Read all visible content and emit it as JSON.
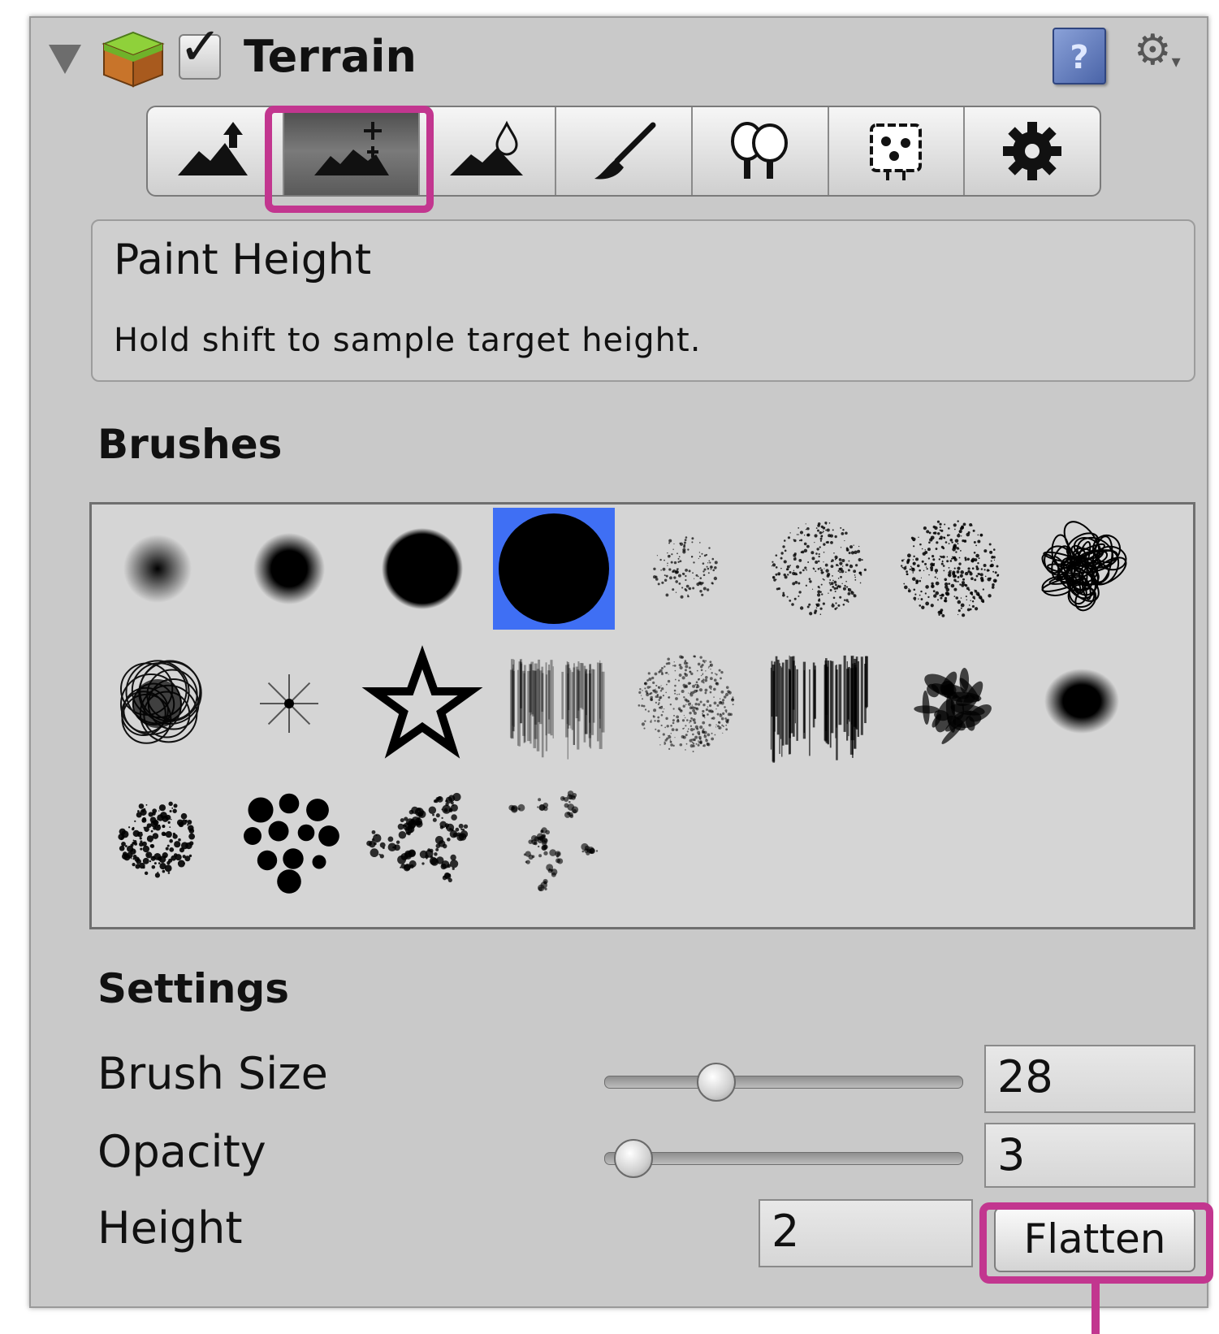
{
  "header": {
    "title": "Terrain",
    "enabled": true,
    "checkbox_glyph": "✓",
    "help_glyph": "?",
    "gear_glyph": "⚙",
    "menu_glyph": "▾"
  },
  "toolbar": {
    "tools": [
      {
        "name": "raise-lower-terrain",
        "icon": "mountain-up-arrow-icon",
        "selected": false
      },
      {
        "name": "paint-height",
        "icon": "mountain-plus-icon",
        "selected": true
      },
      {
        "name": "smooth-height",
        "icon": "mountain-drop-icon",
        "selected": false
      },
      {
        "name": "paint-texture",
        "icon": "paintbrush-icon",
        "selected": false
      },
      {
        "name": "place-trees",
        "icon": "trees-icon",
        "selected": false
      },
      {
        "name": "paint-details",
        "icon": "flowers-icon",
        "selected": false
      },
      {
        "name": "terrain-settings",
        "icon": "gear-icon",
        "selected": false
      }
    ]
  },
  "info": {
    "title": "Paint Height",
    "hint": "Hold shift to sample target height."
  },
  "brushes": {
    "heading": "Brushes",
    "selected_index": 3,
    "count": 20
  },
  "settings": {
    "heading": "Settings",
    "brush_size": {
      "label": "Brush Size",
      "value": "28",
      "slider_fraction": 0.29
    },
    "opacity": {
      "label": "Opacity",
      "value": "3",
      "slider_fraction": 0.03
    },
    "height": {
      "label": "Height",
      "value": "2"
    },
    "flatten_label": "Flatten"
  },
  "colors": {
    "highlight": "#c2368f",
    "selection": "#3f6ff4",
    "panel": "#c9c9c9"
  }
}
